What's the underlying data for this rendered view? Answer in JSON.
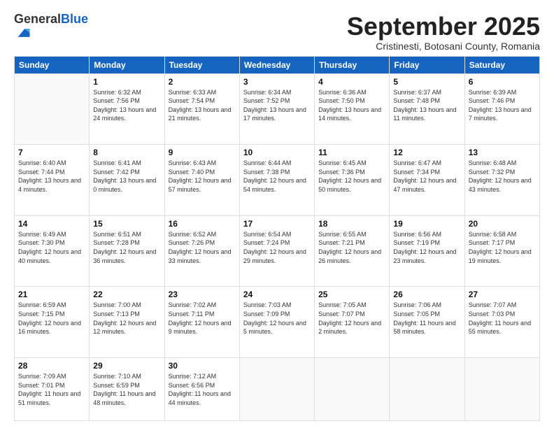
{
  "logo": {
    "general": "General",
    "blue": "Blue"
  },
  "header": {
    "month": "September 2025",
    "location": "Cristinesti, Botosani County, Romania"
  },
  "weekdays": [
    "Sunday",
    "Monday",
    "Tuesday",
    "Wednesday",
    "Thursday",
    "Friday",
    "Saturday"
  ],
  "weeks": [
    [
      {
        "day": "",
        "sunrise": "",
        "sunset": "",
        "daylight": ""
      },
      {
        "day": "1",
        "sunrise": "Sunrise: 6:32 AM",
        "sunset": "Sunset: 7:56 PM",
        "daylight": "Daylight: 13 hours and 24 minutes."
      },
      {
        "day": "2",
        "sunrise": "Sunrise: 6:33 AM",
        "sunset": "Sunset: 7:54 PM",
        "daylight": "Daylight: 13 hours and 21 minutes."
      },
      {
        "day": "3",
        "sunrise": "Sunrise: 6:34 AM",
        "sunset": "Sunset: 7:52 PM",
        "daylight": "Daylight: 13 hours and 17 minutes."
      },
      {
        "day": "4",
        "sunrise": "Sunrise: 6:36 AM",
        "sunset": "Sunset: 7:50 PM",
        "daylight": "Daylight: 13 hours and 14 minutes."
      },
      {
        "day": "5",
        "sunrise": "Sunrise: 6:37 AM",
        "sunset": "Sunset: 7:48 PM",
        "daylight": "Daylight: 13 hours and 11 minutes."
      },
      {
        "day": "6",
        "sunrise": "Sunrise: 6:39 AM",
        "sunset": "Sunset: 7:46 PM",
        "daylight": "Daylight: 13 hours and 7 minutes."
      }
    ],
    [
      {
        "day": "7",
        "sunrise": "Sunrise: 6:40 AM",
        "sunset": "Sunset: 7:44 PM",
        "daylight": "Daylight: 13 hours and 4 minutes."
      },
      {
        "day": "8",
        "sunrise": "Sunrise: 6:41 AM",
        "sunset": "Sunset: 7:42 PM",
        "daylight": "Daylight: 13 hours and 0 minutes."
      },
      {
        "day": "9",
        "sunrise": "Sunrise: 6:43 AM",
        "sunset": "Sunset: 7:40 PM",
        "daylight": "Daylight: 12 hours and 57 minutes."
      },
      {
        "day": "10",
        "sunrise": "Sunrise: 6:44 AM",
        "sunset": "Sunset: 7:38 PM",
        "daylight": "Daylight: 12 hours and 54 minutes."
      },
      {
        "day": "11",
        "sunrise": "Sunrise: 6:45 AM",
        "sunset": "Sunset: 7:36 PM",
        "daylight": "Daylight: 12 hours and 50 minutes."
      },
      {
        "day": "12",
        "sunrise": "Sunrise: 6:47 AM",
        "sunset": "Sunset: 7:34 PM",
        "daylight": "Daylight: 12 hours and 47 minutes."
      },
      {
        "day": "13",
        "sunrise": "Sunrise: 6:48 AM",
        "sunset": "Sunset: 7:32 PM",
        "daylight": "Daylight: 12 hours and 43 minutes."
      }
    ],
    [
      {
        "day": "14",
        "sunrise": "Sunrise: 6:49 AM",
        "sunset": "Sunset: 7:30 PM",
        "daylight": "Daylight: 12 hours and 40 minutes."
      },
      {
        "day": "15",
        "sunrise": "Sunrise: 6:51 AM",
        "sunset": "Sunset: 7:28 PM",
        "daylight": "Daylight: 12 hours and 36 minutes."
      },
      {
        "day": "16",
        "sunrise": "Sunrise: 6:52 AM",
        "sunset": "Sunset: 7:26 PM",
        "daylight": "Daylight: 12 hours and 33 minutes."
      },
      {
        "day": "17",
        "sunrise": "Sunrise: 6:54 AM",
        "sunset": "Sunset: 7:24 PM",
        "daylight": "Daylight: 12 hours and 29 minutes."
      },
      {
        "day": "18",
        "sunrise": "Sunrise: 6:55 AM",
        "sunset": "Sunset: 7:21 PM",
        "daylight": "Daylight: 12 hours and 26 minutes."
      },
      {
        "day": "19",
        "sunrise": "Sunrise: 6:56 AM",
        "sunset": "Sunset: 7:19 PM",
        "daylight": "Daylight: 12 hours and 23 minutes."
      },
      {
        "day": "20",
        "sunrise": "Sunrise: 6:58 AM",
        "sunset": "Sunset: 7:17 PM",
        "daylight": "Daylight: 12 hours and 19 minutes."
      }
    ],
    [
      {
        "day": "21",
        "sunrise": "Sunrise: 6:59 AM",
        "sunset": "Sunset: 7:15 PM",
        "daylight": "Daylight: 12 hours and 16 minutes."
      },
      {
        "day": "22",
        "sunrise": "Sunrise: 7:00 AM",
        "sunset": "Sunset: 7:13 PM",
        "daylight": "Daylight: 12 hours and 12 minutes."
      },
      {
        "day": "23",
        "sunrise": "Sunrise: 7:02 AM",
        "sunset": "Sunset: 7:11 PM",
        "daylight": "Daylight: 12 hours and 9 minutes."
      },
      {
        "day": "24",
        "sunrise": "Sunrise: 7:03 AM",
        "sunset": "Sunset: 7:09 PM",
        "daylight": "Daylight: 12 hours and 5 minutes."
      },
      {
        "day": "25",
        "sunrise": "Sunrise: 7:05 AM",
        "sunset": "Sunset: 7:07 PM",
        "daylight": "Daylight: 12 hours and 2 minutes."
      },
      {
        "day": "26",
        "sunrise": "Sunrise: 7:06 AM",
        "sunset": "Sunset: 7:05 PM",
        "daylight": "Daylight: 11 hours and 58 minutes."
      },
      {
        "day": "27",
        "sunrise": "Sunrise: 7:07 AM",
        "sunset": "Sunset: 7:03 PM",
        "daylight": "Daylight: 11 hours and 55 minutes."
      }
    ],
    [
      {
        "day": "28",
        "sunrise": "Sunrise: 7:09 AM",
        "sunset": "Sunset: 7:01 PM",
        "daylight": "Daylight: 11 hours and 51 minutes."
      },
      {
        "day": "29",
        "sunrise": "Sunrise: 7:10 AM",
        "sunset": "Sunset: 6:59 PM",
        "daylight": "Daylight: 11 hours and 48 minutes."
      },
      {
        "day": "30",
        "sunrise": "Sunrise: 7:12 AM",
        "sunset": "Sunset: 6:56 PM",
        "daylight": "Daylight: 11 hours and 44 minutes."
      },
      {
        "day": "",
        "sunrise": "",
        "sunset": "",
        "daylight": ""
      },
      {
        "day": "",
        "sunrise": "",
        "sunset": "",
        "daylight": ""
      },
      {
        "day": "",
        "sunrise": "",
        "sunset": "",
        "daylight": ""
      },
      {
        "day": "",
        "sunrise": "",
        "sunset": "",
        "daylight": ""
      }
    ]
  ]
}
